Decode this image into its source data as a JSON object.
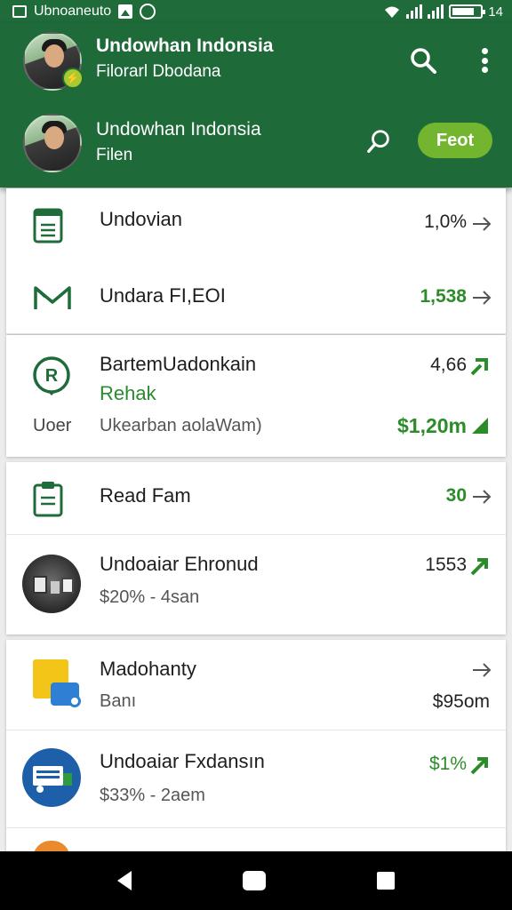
{
  "status_bar": {
    "left_text": "Ubnoaneuto",
    "right_text": "14"
  },
  "header": {
    "account": {
      "title": "Undowhan Indonsia",
      "subtitle": "Filorarl Dbodana"
    },
    "profile": {
      "title": "Undowhan Indonsia",
      "subtitle": "Filen"
    },
    "feed_button": "Feot",
    "colors": {
      "primary": "#1e6a39",
      "accent": "#73b52f"
    }
  },
  "cards": [
    {
      "rows": [
        {
          "icon": "document-icon",
          "title": "Undovian",
          "value": "1,0%",
          "value_color": "dark",
          "trail": "arrow"
        },
        {
          "icon": "chart-line-icon",
          "title": "Undara FI,EOI",
          "value": "1,538",
          "value_color": "green",
          "trail": "arrow"
        }
      ]
    },
    {
      "rows": [
        {
          "icon": "location-pin-icon",
          "title": "BartemUadonkain",
          "subtitle": "Rehak",
          "value": "4,66",
          "left_label": "Uoer",
          "detail": "Ukearban aolaWam)",
          "detail_value": "$1,20m"
        }
      ]
    },
    {
      "rows": [
        {
          "icon": "clipboard-icon",
          "title": "Read Fam",
          "value": "30",
          "value_color": "green",
          "trail": "arrow"
        },
        {
          "icon": "product-photo-icon",
          "title": "Undoaiar Ehronud",
          "subtitle": "$20% - 4san",
          "value": "1553",
          "value_color": "dark",
          "trail": "trend"
        }
      ]
    },
    {
      "rows": [
        {
          "icon": "wallet-cards-icon",
          "title": "Madohanty",
          "subtitle": "Banı",
          "value": "$95om",
          "trail": "arrow"
        },
        {
          "icon": "delivery-truck-icon",
          "title": "Undoaiar Fxdansın",
          "subtitle": "$33% - 2aem",
          "value": "$1%",
          "value_color": "green",
          "trail": "trend"
        }
      ]
    }
  ]
}
